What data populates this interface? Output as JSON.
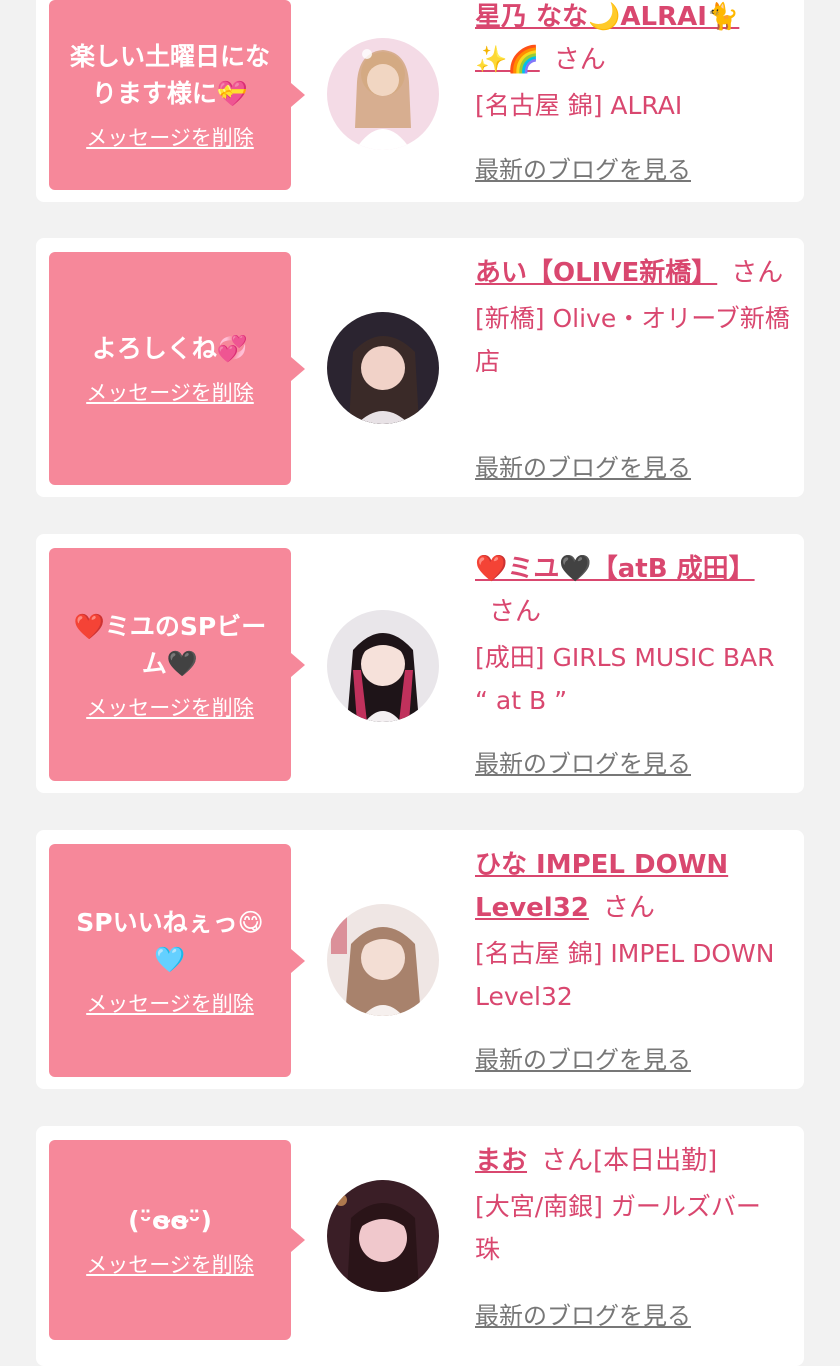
{
  "colors": {
    "accent": "#d9476f",
    "bubble": "#f6889a",
    "background": "#f2f2f2"
  },
  "entries": [
    {
      "message": "楽しい土曜日にな\nります様に💝",
      "delete_label": "メッセージを削除",
      "name": "星乃 なな🌙ALRAI🐈\n✨🌈",
      "san": "さん",
      "shop": "[名古屋 錦] ALRAI",
      "blog_label": "最新のブログを見る"
    },
    {
      "message": "よろしくね💞",
      "delete_label": "メッセージを削除",
      "name": "あい【OLIVE新橋】",
      "san": "さん",
      "shop": "[新橋] Olive・オリーブ新橋店",
      "blog_label": "最新のブログを見る"
    },
    {
      "message": "❤️ミユのSPビー\nム🖤",
      "delete_label": "メッセージを削除",
      "name": "❤️ミユ🖤【atB 成田】",
      "san": "さん",
      "shop": "[成田] GIRLS MUSIC BAR “ at B ”",
      "blog_label": "最新のブログを見る"
    },
    {
      "message": "SPいいねぇっ😋\n🩵",
      "delete_label": "メッセージを削除",
      "name": "ひな IMPEL DOWN Level32",
      "san": "さん",
      "shop": "[名古屋 錦] IMPEL DOWN Level32",
      "blog_label": "最新のブログを見る"
    },
    {
      "message": "(ᵕ̈ɞ̴ɞ̴ᵕ̈)",
      "delete_label": "メッセージを削除",
      "name": "まお",
      "san": "さん[本日出勤]",
      "shop": "[大宮/南銀] ガールズバー 珠",
      "blog_label": "最新のブログを見る"
    }
  ]
}
